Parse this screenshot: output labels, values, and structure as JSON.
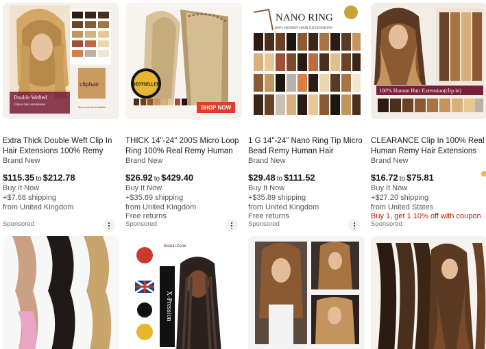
{
  "row1": [
    {
      "image_label": "hair-extension-photo",
      "image_texts": [
        "Double Wefted",
        "Clip-in hair extensions",
        "cliphair",
        "More colours available"
      ],
      "title": "Extra Thick Double Weft Clip In Hair Extensions 100% Remy Human Hair...",
      "condition": "Brand New",
      "price_low": "$115.35",
      "price_sep": "to",
      "price_high": "$212.78",
      "buy": "Buy It Now",
      "shipping": "+$7.68 shipping",
      "location": "from United Kingdom",
      "extra": "",
      "sponsored": "Sponsored"
    },
    {
      "image_label": "micro-loop-hair-photo",
      "image_texts": [
        "BESTSELLER",
        "SHOP NOW"
      ],
      "title": "THICK 14\"-24\" 200S Micro Loop Ring 100% Real Remy Human Hair...",
      "condition": "Brand New",
      "price_low": "$26.92",
      "price_sep": "to",
      "price_high": "$429.40",
      "buy": "Buy It Now",
      "shipping": "+$35.89 shipping",
      "location": "from United Kingdom",
      "extra": "Free returns",
      "sponsored": "Sponsored"
    },
    {
      "image_label": "nano-ring-hair-photo",
      "image_texts": [
        "NANO RING",
        "100% HUMAN HAIR EXTENSIONS"
      ],
      "title": "1 G 14\"-24\" Nano Ring Tip Micro Bead Remy Human Hair Extensions 1g...",
      "condition": "Brand New",
      "price_low": "$29.48",
      "price_sep": "to",
      "price_high": "$111.52",
      "buy": "Buy It Now",
      "shipping": "+$35.89 shipping",
      "location": "from United Kingdom",
      "extra": "Free returns",
      "sponsored": "Sponsored"
    },
    {
      "image_label": "clip-in-hair-photo",
      "image_texts": [
        "100% Human Hair Extension(clip in)"
      ],
      "title": "CLEARANCE Clip In 100% Real Human Remy Hair Extensions Full...",
      "condition": "Brand New",
      "price_low": "$16.72",
      "price_sep": "to",
      "price_high": "$75.81",
      "buy": "Buy It Now",
      "shipping": "+$27.20 shipping",
      "location": "from United States",
      "extra": "Buy 1, get 1 10% off with coupon",
      "sponsored": "Sponsored"
    }
  ],
  "row2": [
    {
      "image_label": "crochet-braid-hair-photo"
    },
    {
      "image_label": "braiding-hair-photo",
      "image_texts": [
        "Beauti Zone",
        "X-Pression"
      ]
    },
    {
      "image_label": "curly-hair-models-photo"
    },
    {
      "image_label": "long-hair-extensions-photo"
    }
  ],
  "colors": {
    "accent_red": "#c91800",
    "price": "#191919",
    "muted": "#555555",
    "shop_now": "#e43b2d"
  }
}
